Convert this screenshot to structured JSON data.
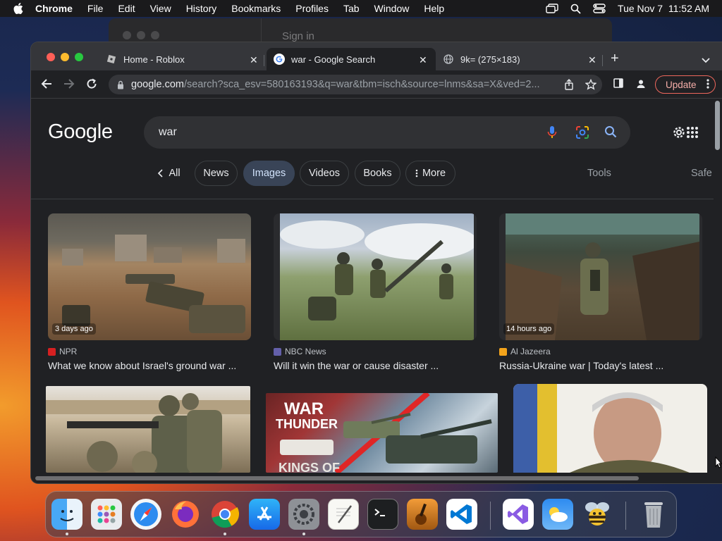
{
  "menubar": {
    "app_name": "Chrome",
    "items": [
      "File",
      "Edit",
      "View",
      "History",
      "Bookmarks",
      "Profiles",
      "Tab",
      "Window",
      "Help"
    ],
    "datetime": "Tue Nov 7  11:52 AM"
  },
  "background_window": {
    "text": "Sign in"
  },
  "tabs": [
    {
      "title": "Home - Roblox",
      "favicon": "roblox-icon"
    },
    {
      "title": "war - Google Search",
      "favicon": "google-icon",
      "active": true
    },
    {
      "title": "9k= (275×183)",
      "favicon": "globe-icon"
    }
  ],
  "toolbar": {
    "url_host": "google.com",
    "url_path": "/search?sca_esv=580163193&q=war&tbm=isch&source=lnms&sa=X&ved=2...",
    "update_label": "Update"
  },
  "page": {
    "logo": "Google",
    "search_query": "war",
    "chips": [
      "All",
      "News",
      "Images",
      "Videos",
      "Books",
      "More"
    ],
    "active_chip": "Images",
    "tools_label": "Tools",
    "safesearch_label": "Safe"
  },
  "results": [
    {
      "source": "NPR",
      "title": "What we know about Israel's ground war ...",
      "badge": "3 days ago",
      "source_color": "#d62021"
    },
    {
      "source": "NBC News",
      "title": "Will it win the war or cause disaster ...",
      "badge": "",
      "source_color": "#6460aa"
    },
    {
      "source": "Al Jazeera",
      "title": "Russia-Ukraine war | Today's latest ...",
      "badge": "14 hours ago",
      "source_color": "#f2a31b"
    },
    {
      "source": "",
      "title": "",
      "badge": ""
    },
    {
      "source": "",
      "title": "",
      "badge": "",
      "image_text_1": "WAR",
      "image_text_2": "THUNDER",
      "image_text_3": "KINGS OF"
    },
    {
      "source": "",
      "title": "",
      "badge": ""
    }
  ],
  "dock": {
    "apps": [
      "finder-icon",
      "launchpad-icon",
      "safari-icon",
      "firefox-icon",
      "chrome-icon",
      "app-store-icon",
      "system-settings-icon",
      "textedit-icon",
      "terminal-icon",
      "garageband-icon",
      "vscode-icon",
      "visual-studio-icon",
      "weather-icon",
      "bee-app-icon",
      "trash-icon"
    ]
  },
  "colors": {
    "accent_blue": "#8ab4f8",
    "update_red": "#ee675c",
    "active_chip_bg": "#394457"
  }
}
